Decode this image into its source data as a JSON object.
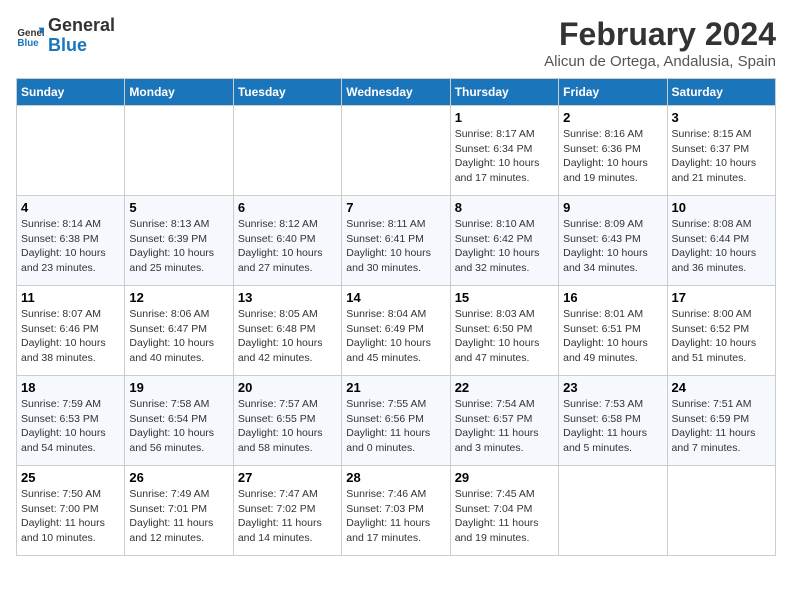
{
  "header": {
    "logo_line1": "General",
    "logo_line2": "Blue",
    "title": "February 2024",
    "subtitle": "Alicun de Ortega, Andalusia, Spain"
  },
  "days_of_week": [
    "Sunday",
    "Monday",
    "Tuesday",
    "Wednesday",
    "Thursday",
    "Friday",
    "Saturday"
  ],
  "weeks": [
    {
      "cells": [
        {
          "day": "",
          "info": ""
        },
        {
          "day": "",
          "info": ""
        },
        {
          "day": "",
          "info": ""
        },
        {
          "day": "",
          "info": ""
        },
        {
          "day": "1",
          "info": "Sunrise: 8:17 AM\nSunset: 6:34 PM\nDaylight: 10 hours\nand 17 minutes."
        },
        {
          "day": "2",
          "info": "Sunrise: 8:16 AM\nSunset: 6:36 PM\nDaylight: 10 hours\nand 19 minutes."
        },
        {
          "day": "3",
          "info": "Sunrise: 8:15 AM\nSunset: 6:37 PM\nDaylight: 10 hours\nand 21 minutes."
        }
      ]
    },
    {
      "cells": [
        {
          "day": "4",
          "info": "Sunrise: 8:14 AM\nSunset: 6:38 PM\nDaylight: 10 hours\nand 23 minutes."
        },
        {
          "day": "5",
          "info": "Sunrise: 8:13 AM\nSunset: 6:39 PM\nDaylight: 10 hours\nand 25 minutes."
        },
        {
          "day": "6",
          "info": "Sunrise: 8:12 AM\nSunset: 6:40 PM\nDaylight: 10 hours\nand 27 minutes."
        },
        {
          "day": "7",
          "info": "Sunrise: 8:11 AM\nSunset: 6:41 PM\nDaylight: 10 hours\nand 30 minutes."
        },
        {
          "day": "8",
          "info": "Sunrise: 8:10 AM\nSunset: 6:42 PM\nDaylight: 10 hours\nand 32 minutes."
        },
        {
          "day": "9",
          "info": "Sunrise: 8:09 AM\nSunset: 6:43 PM\nDaylight: 10 hours\nand 34 minutes."
        },
        {
          "day": "10",
          "info": "Sunrise: 8:08 AM\nSunset: 6:44 PM\nDaylight: 10 hours\nand 36 minutes."
        }
      ]
    },
    {
      "cells": [
        {
          "day": "11",
          "info": "Sunrise: 8:07 AM\nSunset: 6:46 PM\nDaylight: 10 hours\nand 38 minutes."
        },
        {
          "day": "12",
          "info": "Sunrise: 8:06 AM\nSunset: 6:47 PM\nDaylight: 10 hours\nand 40 minutes."
        },
        {
          "day": "13",
          "info": "Sunrise: 8:05 AM\nSunset: 6:48 PM\nDaylight: 10 hours\nand 42 minutes."
        },
        {
          "day": "14",
          "info": "Sunrise: 8:04 AM\nSunset: 6:49 PM\nDaylight: 10 hours\nand 45 minutes."
        },
        {
          "day": "15",
          "info": "Sunrise: 8:03 AM\nSunset: 6:50 PM\nDaylight: 10 hours\nand 47 minutes."
        },
        {
          "day": "16",
          "info": "Sunrise: 8:01 AM\nSunset: 6:51 PM\nDaylight: 10 hours\nand 49 minutes."
        },
        {
          "day": "17",
          "info": "Sunrise: 8:00 AM\nSunset: 6:52 PM\nDaylight: 10 hours\nand 51 minutes."
        }
      ]
    },
    {
      "cells": [
        {
          "day": "18",
          "info": "Sunrise: 7:59 AM\nSunset: 6:53 PM\nDaylight: 10 hours\nand 54 minutes."
        },
        {
          "day": "19",
          "info": "Sunrise: 7:58 AM\nSunset: 6:54 PM\nDaylight: 10 hours\nand 56 minutes."
        },
        {
          "day": "20",
          "info": "Sunrise: 7:57 AM\nSunset: 6:55 PM\nDaylight: 10 hours\nand 58 minutes."
        },
        {
          "day": "21",
          "info": "Sunrise: 7:55 AM\nSunset: 6:56 PM\nDaylight: 11 hours\nand 0 minutes."
        },
        {
          "day": "22",
          "info": "Sunrise: 7:54 AM\nSunset: 6:57 PM\nDaylight: 11 hours\nand 3 minutes."
        },
        {
          "day": "23",
          "info": "Sunrise: 7:53 AM\nSunset: 6:58 PM\nDaylight: 11 hours\nand 5 minutes."
        },
        {
          "day": "24",
          "info": "Sunrise: 7:51 AM\nSunset: 6:59 PM\nDaylight: 11 hours\nand 7 minutes."
        }
      ]
    },
    {
      "cells": [
        {
          "day": "25",
          "info": "Sunrise: 7:50 AM\nSunset: 7:00 PM\nDaylight: 11 hours\nand 10 minutes."
        },
        {
          "day": "26",
          "info": "Sunrise: 7:49 AM\nSunset: 7:01 PM\nDaylight: 11 hours\nand 12 minutes."
        },
        {
          "day": "27",
          "info": "Sunrise: 7:47 AM\nSunset: 7:02 PM\nDaylight: 11 hours\nand 14 minutes."
        },
        {
          "day": "28",
          "info": "Sunrise: 7:46 AM\nSunset: 7:03 PM\nDaylight: 11 hours\nand 17 minutes."
        },
        {
          "day": "29",
          "info": "Sunrise: 7:45 AM\nSunset: 7:04 PM\nDaylight: 11 hours\nand 19 minutes."
        },
        {
          "day": "",
          "info": ""
        },
        {
          "day": "",
          "info": ""
        }
      ]
    }
  ]
}
